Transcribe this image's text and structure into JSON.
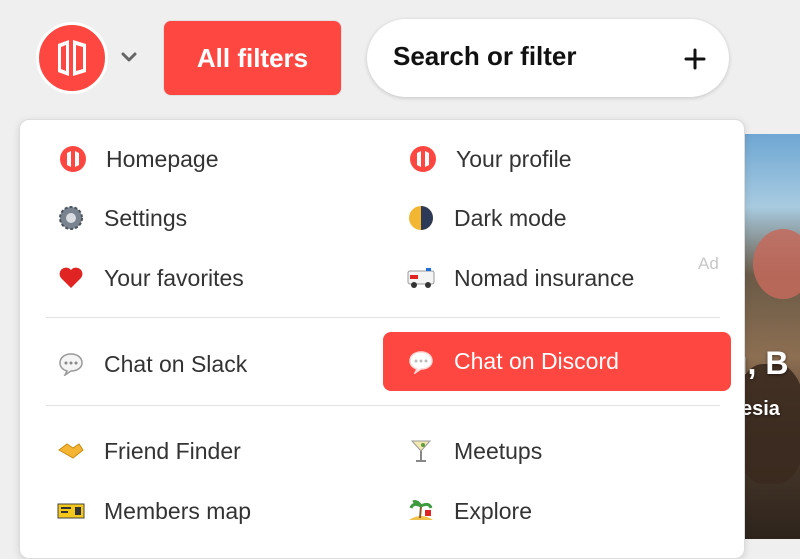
{
  "topbar": {
    "all_filters_label": "All filters",
    "search_placeholder": "Search or filter",
    "plus_symbol": "+"
  },
  "menu": {
    "ad_label": "Ad",
    "items": {
      "homepage": "Homepage",
      "your_profile": "Your profile",
      "settings": "Settings",
      "dark_mode": "Dark mode",
      "your_favorites": "Your favorites",
      "nomad_insurance": "Nomad insurance",
      "chat_on_slack": "Chat on Slack",
      "chat_on_discord": "Chat on Discord",
      "friend_finder": "Friend Finder",
      "meetups": "Meetups",
      "members_map": "Members map",
      "explore": "Explore"
    },
    "icons": {
      "homepage": "nomad-logo-icon",
      "your_profile": "nomad-logo-icon",
      "settings": "gear-icon",
      "dark_mode": "moon-icon",
      "your_favorites": "heart-icon",
      "nomad_insurance": "ambulance-icon",
      "chat_on_slack": "speech-bubble-icon",
      "chat_on_discord": "speech-bubble-icon",
      "friend_finder": "handshake-icon",
      "meetups": "cocktail-icon",
      "members_map": "map-icon",
      "explore": "island-icon"
    }
  },
  "background": {
    "headline": "u, B",
    "subline": "esia"
  },
  "colors": {
    "brand": "#ff4742",
    "highlight_text": "#ffffff"
  }
}
